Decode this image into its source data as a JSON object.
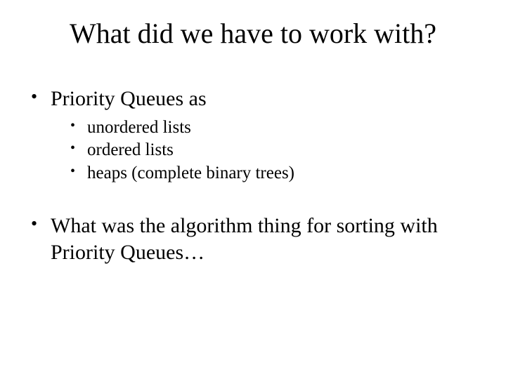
{
  "title": "What did we have to work with?",
  "bullets": {
    "b1": "Priority Queues as",
    "b1_sub": {
      "s1": "unordered lists",
      "s2": "ordered lists",
      "s3": "heaps (complete binary trees)"
    },
    "b2": "What was the algorithm thing for sorting with Priority Queues…"
  }
}
